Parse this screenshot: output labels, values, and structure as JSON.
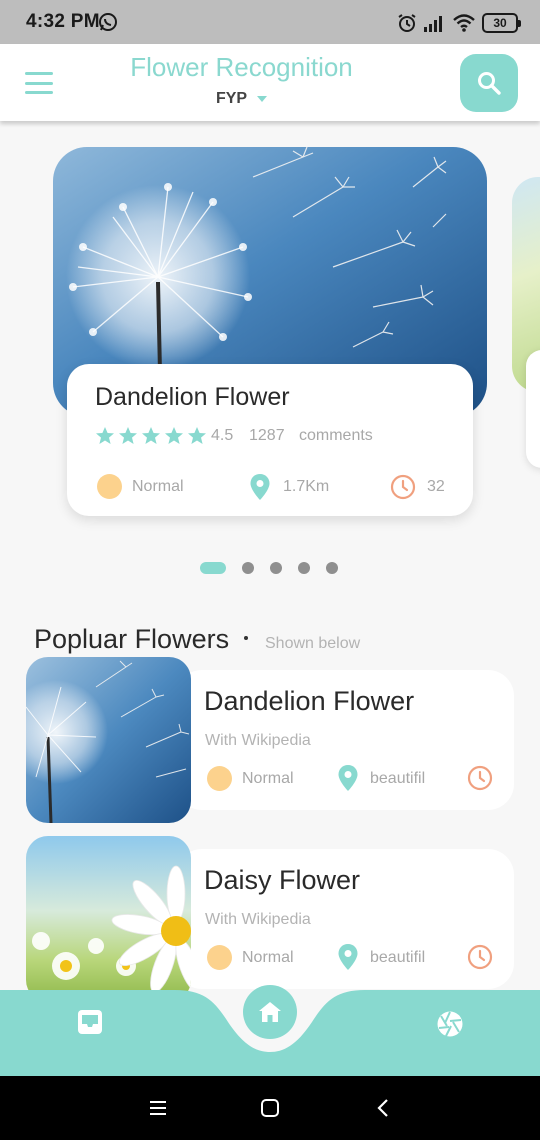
{
  "status_bar": {
    "time": "4:32 PM",
    "battery": "30",
    "icons": [
      "whatsapp-icon",
      "alarm-icon",
      "signal-icon",
      "wifi-icon",
      "battery-icon"
    ]
  },
  "header": {
    "title": "Flower Recognition",
    "project": "FYP",
    "menu_icon": "hamburger-icon",
    "search_icon": "search-icon"
  },
  "featured": {
    "name": "Dandelion Flower",
    "stars": 5,
    "rating": "4.5",
    "count": "1287",
    "comments_label": "comments",
    "status": "Normal",
    "distance": "1.7Km",
    "time": "32"
  },
  "pager": {
    "total": 5,
    "active": 0
  },
  "popular": {
    "title": "Popluar Flowers",
    "subtitle": "Shown below",
    "items": [
      {
        "name": "Dandelion Flower",
        "source": "With Wikipedia",
        "status": "Normal",
        "tag": "beautifil"
      },
      {
        "name": "Daisy Flower",
        "source": "With Wikipedia",
        "status": "Normal",
        "tag": "beautifil"
      }
    ]
  },
  "bottom_nav": {
    "items": [
      "inbox-icon",
      "home-icon",
      "aperture-icon"
    ],
    "active": "home-icon"
  },
  "system_nav": [
    "recents-icon",
    "home-icon",
    "back-icon"
  ],
  "colors": {
    "accent": "#88d9cf",
    "status_dot": "#fcd28d",
    "clock": "#f0a07f",
    "background": "#f7f7f7"
  }
}
